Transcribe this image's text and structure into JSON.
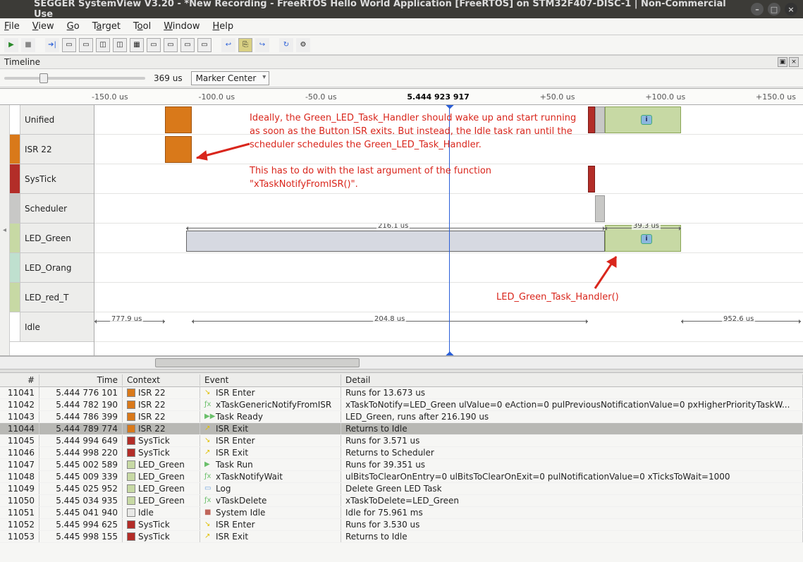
{
  "window": {
    "title": "SEGGER SystemView V3.20 - *New Recording - FreeRTOS Hello World Application [FreeRTOS] on STM32F407-DISC-1 | Non-Commercial Use"
  },
  "menu": [
    "File",
    "View",
    "Go",
    "Target",
    "Tool",
    "Window",
    "Help"
  ],
  "timeline": {
    "panel_title": "Timeline",
    "zoom": "369 us",
    "marker_mode": "Marker Center",
    "ruler_center": "5.444 923 917",
    "ruler_ticks": [
      "-150.0 us",
      "-100.0 us",
      "-50.0 us",
      "",
      "+50.0 us",
      "+100.0 us",
      "+150.0 us"
    ],
    "tracks": [
      "Unified",
      "ISR 22",
      "SysTick",
      "Scheduler",
      "LED_Green",
      "LED_Orang",
      "LED_red_T",
      "Idle"
    ],
    "dims": {
      "span1": "216.1 us",
      "span2": "39.3 us",
      "idle_left": "777.9 us",
      "idle_mid": "204.8 us",
      "idle_right": "952.6 us"
    }
  },
  "annotation": {
    "text": "Ideally, the Green_LED_Task_Handler should wake up and start running as soon as the Button ISR exits. But instead, the Idle task ran until the scheduler schedules the Green_LED_Task_Handler.\n\nThis has to do with the last argument of the function \"xTaskNotifyFromISR()\".",
    "label2": "LED_Green_Task_Handler()"
  },
  "events": {
    "headers": [
      "#",
      "Time",
      "Context",
      "Event",
      "Detail"
    ],
    "rows": [
      {
        "n": "11041",
        "t": "5.444 776 101",
        "ctx": "ISR 22",
        "ctxcol": "#d9791a",
        "evico": "enter",
        "ev": "ISR Enter",
        "det": "Runs for 13.673 us"
      },
      {
        "n": "11042",
        "t": "5.444 782 190",
        "ctx": "ISR 22",
        "ctxcol": "#d9791a",
        "evico": "fx",
        "ev": "xTaskGenericNotifyFromISR",
        "det": "xTaskToNotify=LED_Green ulValue=0 eAction=0 pulPreviousNotificationValue=0 pxHigherPriorityTaskW..."
      },
      {
        "n": "11043",
        "t": "5.444 786 399",
        "ctx": "ISR 22",
        "ctxcol": "#d9791a",
        "evico": "ready",
        "ev": "Task Ready",
        "det": "LED_Green, runs after 216.190 us"
      },
      {
        "n": "11044",
        "t": "5.444 789 774",
        "ctx": "ISR 22",
        "ctxcol": "#d9791a",
        "evico": "exit",
        "ev": "ISR Exit",
        "det": "Returns to Idle",
        "sel": true
      },
      {
        "n": "11045",
        "t": "5.444 994 649",
        "ctx": "SysTick",
        "ctxcol": "#b32d28",
        "evico": "enter",
        "ev": "ISR Enter",
        "det": "Runs for 3.571 us"
      },
      {
        "n": "11046",
        "t": "5.444 998 220",
        "ctx": "SysTick",
        "ctxcol": "#b32d28",
        "evico": "exit",
        "ev": "ISR Exit",
        "det": "Returns to Scheduler"
      },
      {
        "n": "11047",
        "t": "5.445 002 589",
        "ctx": "LED_Green",
        "ctxcol": "#c7d9a4",
        "evico": "run",
        "ev": "Task Run",
        "det": "Runs for 39.351 us"
      },
      {
        "n": "11048",
        "t": "5.445 009 339",
        "ctx": "LED_Green",
        "ctxcol": "#c7d9a4",
        "evico": "fx",
        "ev": "xTaskNotifyWait",
        "det": "ulBitsToClearOnEntry=0 ulBitsToClearOnExit=0 pulNotificationValue=0 xTicksToWait=1000"
      },
      {
        "n": "11049",
        "t": "5.445 025 952",
        "ctx": "LED_Green",
        "ctxcol": "#c7d9a4",
        "evico": "log",
        "ev": "Log",
        "det": "Delete Green LED Task"
      },
      {
        "n": "11050",
        "t": "5.445 034 935",
        "ctx": "LED_Green",
        "ctxcol": "#c7d9a4",
        "evico": "fx",
        "ev": "vTaskDelete",
        "det": "xTaskToDelete=LED_Green"
      },
      {
        "n": "11051",
        "t": "5.445 041 940",
        "ctx": "Idle",
        "ctxcol": "#e8e8e6",
        "evico": "idle",
        "ev": "System Idle",
        "det": "Idle for 75.961 ms"
      },
      {
        "n": "11052",
        "t": "5.445 994 625",
        "ctx": "SysTick",
        "ctxcol": "#b32d28",
        "evico": "enter",
        "ev": "ISR Enter",
        "det": "Runs for 3.530 us"
      },
      {
        "n": "11053",
        "t": "5.445 998 155",
        "ctx": "SysTick",
        "ctxcol": "#b32d28",
        "evico": "exit",
        "ev": "ISR Exit",
        "det": "Returns to Idle"
      }
    ]
  },
  "colors": {
    "Unified": "#fff",
    "ISR 22": "#d9791a",
    "SysTick": "#b32d28",
    "Scheduler": "#c8c8c6",
    "LED_Green": "#c7d9a4",
    "LED_Orang": "#bfe0cf",
    "LED_red_T": "#c7d9a4",
    "Idle": "#fff"
  }
}
